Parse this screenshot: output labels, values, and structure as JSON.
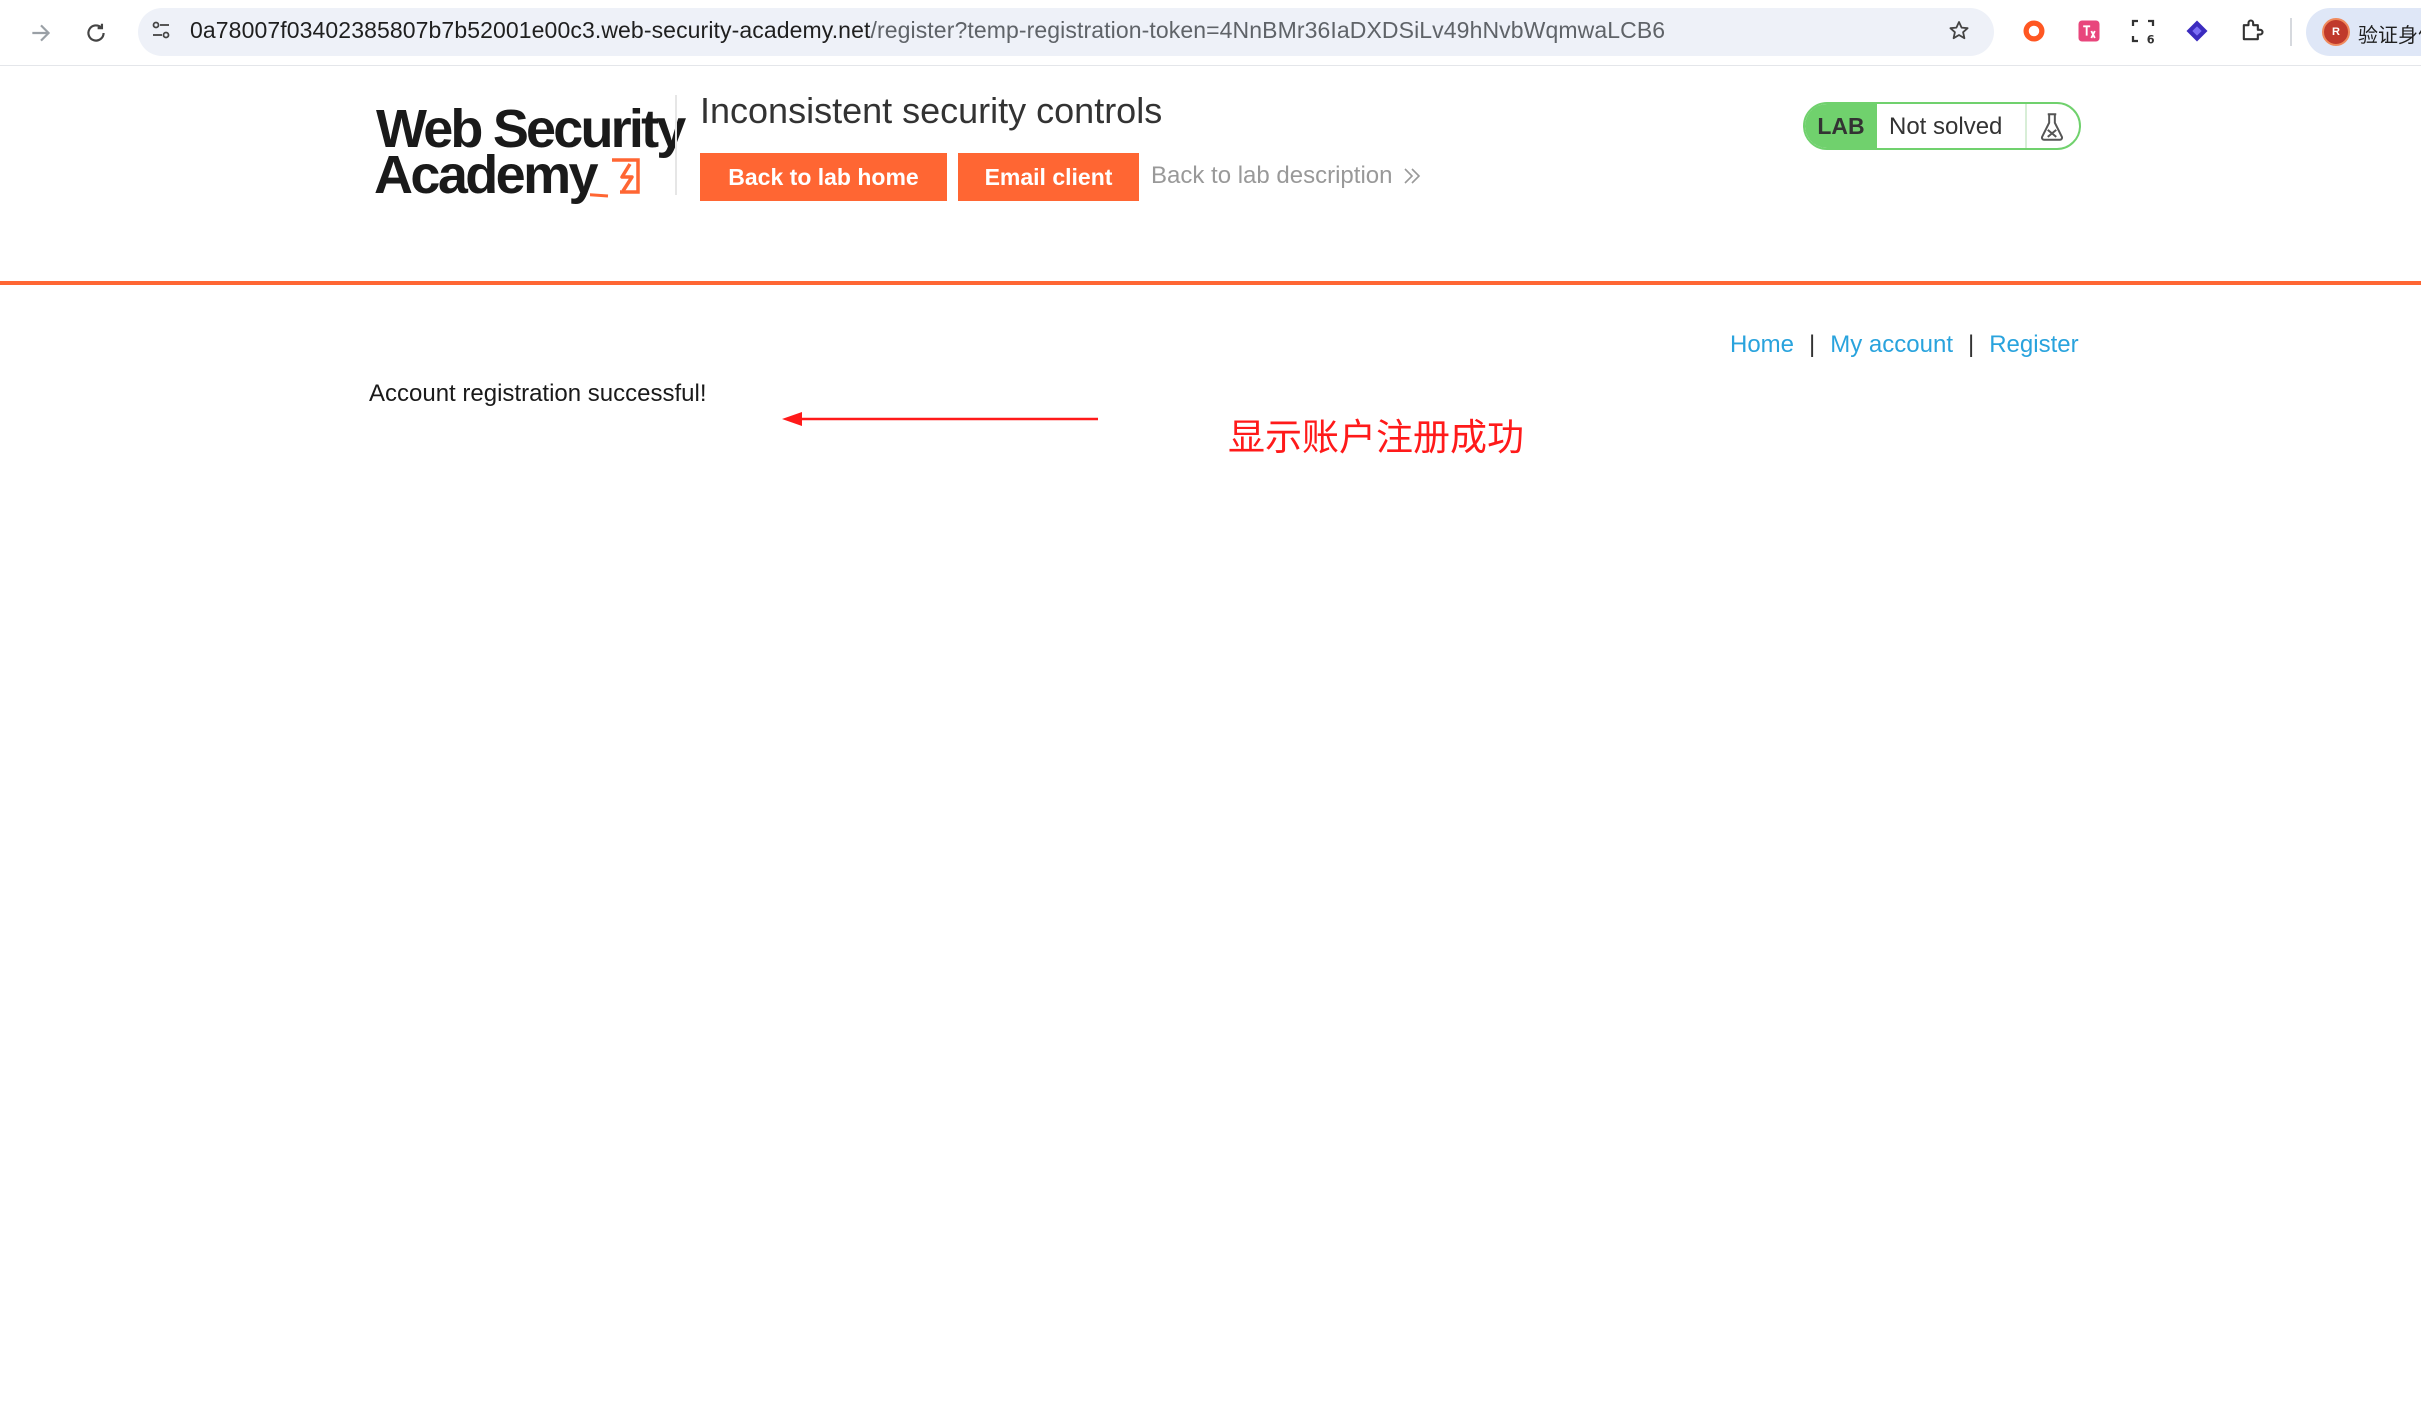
{
  "browser": {
    "url_host": "0a78007f03402385807b7b52001e00c3.web-security-academy.net",
    "url_path": "/register?temp-registration-token=4NnBMr36IaDXDSiLv49hNvbWqmwaLCB6",
    "profile_label": "验证身份",
    "profile_avatar_text": "R",
    "ext_badge_count": "6"
  },
  "header": {
    "logo_line1": "Web Security",
    "logo_line2": "Academy",
    "lab_title": "Inconsistent security controls",
    "back_to_lab_home": "Back to lab home",
    "email_client": "Email client",
    "back_to_lab_description": "Back to lab description",
    "lab_badge": "LAB",
    "lab_status": "Not solved"
  },
  "nav": {
    "home": "Home",
    "separator": "|",
    "my_account": "My account",
    "register": "Register"
  },
  "main": {
    "message": "Account registration successful!"
  },
  "annotation": {
    "text": "显示账户注册成功",
    "color": "#ff1a1a"
  },
  "colors": {
    "accent": "#ff6633",
    "lab_green": "#70d16d",
    "link": "#29a3dd"
  }
}
